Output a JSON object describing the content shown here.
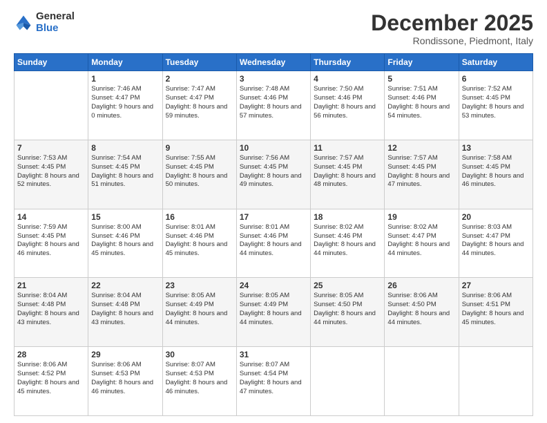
{
  "header": {
    "logo_general": "General",
    "logo_blue": "Blue",
    "month_title": "December 2025",
    "location": "Rondissone, Piedmont, Italy"
  },
  "days_of_week": [
    "Sunday",
    "Monday",
    "Tuesday",
    "Wednesday",
    "Thursday",
    "Friday",
    "Saturday"
  ],
  "weeks": [
    [
      {
        "day": "",
        "sunrise": "",
        "sunset": "",
        "daylight": ""
      },
      {
        "day": "1",
        "sunrise": "Sunrise: 7:46 AM",
        "sunset": "Sunset: 4:47 PM",
        "daylight": "Daylight: 9 hours and 0 minutes."
      },
      {
        "day": "2",
        "sunrise": "Sunrise: 7:47 AM",
        "sunset": "Sunset: 4:47 PM",
        "daylight": "Daylight: 8 hours and 59 minutes."
      },
      {
        "day": "3",
        "sunrise": "Sunrise: 7:48 AM",
        "sunset": "Sunset: 4:46 PM",
        "daylight": "Daylight: 8 hours and 57 minutes."
      },
      {
        "day": "4",
        "sunrise": "Sunrise: 7:50 AM",
        "sunset": "Sunset: 4:46 PM",
        "daylight": "Daylight: 8 hours and 56 minutes."
      },
      {
        "day": "5",
        "sunrise": "Sunrise: 7:51 AM",
        "sunset": "Sunset: 4:46 PM",
        "daylight": "Daylight: 8 hours and 54 minutes."
      },
      {
        "day": "6",
        "sunrise": "Sunrise: 7:52 AM",
        "sunset": "Sunset: 4:45 PM",
        "daylight": "Daylight: 8 hours and 53 minutes."
      }
    ],
    [
      {
        "day": "7",
        "sunrise": "Sunrise: 7:53 AM",
        "sunset": "Sunset: 4:45 PM",
        "daylight": "Daylight: 8 hours and 52 minutes."
      },
      {
        "day": "8",
        "sunrise": "Sunrise: 7:54 AM",
        "sunset": "Sunset: 4:45 PM",
        "daylight": "Daylight: 8 hours and 51 minutes."
      },
      {
        "day": "9",
        "sunrise": "Sunrise: 7:55 AM",
        "sunset": "Sunset: 4:45 PM",
        "daylight": "Daylight: 8 hours and 50 minutes."
      },
      {
        "day": "10",
        "sunrise": "Sunrise: 7:56 AM",
        "sunset": "Sunset: 4:45 PM",
        "daylight": "Daylight: 8 hours and 49 minutes."
      },
      {
        "day": "11",
        "sunrise": "Sunrise: 7:57 AM",
        "sunset": "Sunset: 4:45 PM",
        "daylight": "Daylight: 8 hours and 48 minutes."
      },
      {
        "day": "12",
        "sunrise": "Sunrise: 7:57 AM",
        "sunset": "Sunset: 4:45 PM",
        "daylight": "Daylight: 8 hours and 47 minutes."
      },
      {
        "day": "13",
        "sunrise": "Sunrise: 7:58 AM",
        "sunset": "Sunset: 4:45 PM",
        "daylight": "Daylight: 8 hours and 46 minutes."
      }
    ],
    [
      {
        "day": "14",
        "sunrise": "Sunrise: 7:59 AM",
        "sunset": "Sunset: 4:45 PM",
        "daylight": "Daylight: 8 hours and 46 minutes."
      },
      {
        "day": "15",
        "sunrise": "Sunrise: 8:00 AM",
        "sunset": "Sunset: 4:46 PM",
        "daylight": "Daylight: 8 hours and 45 minutes."
      },
      {
        "day": "16",
        "sunrise": "Sunrise: 8:01 AM",
        "sunset": "Sunset: 4:46 PM",
        "daylight": "Daylight: 8 hours and 45 minutes."
      },
      {
        "day": "17",
        "sunrise": "Sunrise: 8:01 AM",
        "sunset": "Sunset: 4:46 PM",
        "daylight": "Daylight: 8 hours and 44 minutes."
      },
      {
        "day": "18",
        "sunrise": "Sunrise: 8:02 AM",
        "sunset": "Sunset: 4:46 PM",
        "daylight": "Daylight: 8 hours and 44 minutes."
      },
      {
        "day": "19",
        "sunrise": "Sunrise: 8:02 AM",
        "sunset": "Sunset: 4:47 PM",
        "daylight": "Daylight: 8 hours and 44 minutes."
      },
      {
        "day": "20",
        "sunrise": "Sunrise: 8:03 AM",
        "sunset": "Sunset: 4:47 PM",
        "daylight": "Daylight: 8 hours and 44 minutes."
      }
    ],
    [
      {
        "day": "21",
        "sunrise": "Sunrise: 8:04 AM",
        "sunset": "Sunset: 4:48 PM",
        "daylight": "Daylight: 8 hours and 43 minutes."
      },
      {
        "day": "22",
        "sunrise": "Sunrise: 8:04 AM",
        "sunset": "Sunset: 4:48 PM",
        "daylight": "Daylight: 8 hours and 43 minutes."
      },
      {
        "day": "23",
        "sunrise": "Sunrise: 8:05 AM",
        "sunset": "Sunset: 4:49 PM",
        "daylight": "Daylight: 8 hours and 44 minutes."
      },
      {
        "day": "24",
        "sunrise": "Sunrise: 8:05 AM",
        "sunset": "Sunset: 4:49 PM",
        "daylight": "Daylight: 8 hours and 44 minutes."
      },
      {
        "day": "25",
        "sunrise": "Sunrise: 8:05 AM",
        "sunset": "Sunset: 4:50 PM",
        "daylight": "Daylight: 8 hours and 44 minutes."
      },
      {
        "day": "26",
        "sunrise": "Sunrise: 8:06 AM",
        "sunset": "Sunset: 4:50 PM",
        "daylight": "Daylight: 8 hours and 44 minutes."
      },
      {
        "day": "27",
        "sunrise": "Sunrise: 8:06 AM",
        "sunset": "Sunset: 4:51 PM",
        "daylight": "Daylight: 8 hours and 45 minutes."
      }
    ],
    [
      {
        "day": "28",
        "sunrise": "Sunrise: 8:06 AM",
        "sunset": "Sunset: 4:52 PM",
        "daylight": "Daylight: 8 hours and 45 minutes."
      },
      {
        "day": "29",
        "sunrise": "Sunrise: 8:06 AM",
        "sunset": "Sunset: 4:53 PM",
        "daylight": "Daylight: 8 hours and 46 minutes."
      },
      {
        "day": "30",
        "sunrise": "Sunrise: 8:07 AM",
        "sunset": "Sunset: 4:53 PM",
        "daylight": "Daylight: 8 hours and 46 minutes."
      },
      {
        "day": "31",
        "sunrise": "Sunrise: 8:07 AM",
        "sunset": "Sunset: 4:54 PM",
        "daylight": "Daylight: 8 hours and 47 minutes."
      },
      {
        "day": "",
        "sunrise": "",
        "sunset": "",
        "daylight": ""
      },
      {
        "day": "",
        "sunrise": "",
        "sunset": "",
        "daylight": ""
      },
      {
        "day": "",
        "sunrise": "",
        "sunset": "",
        "daylight": ""
      }
    ]
  ]
}
